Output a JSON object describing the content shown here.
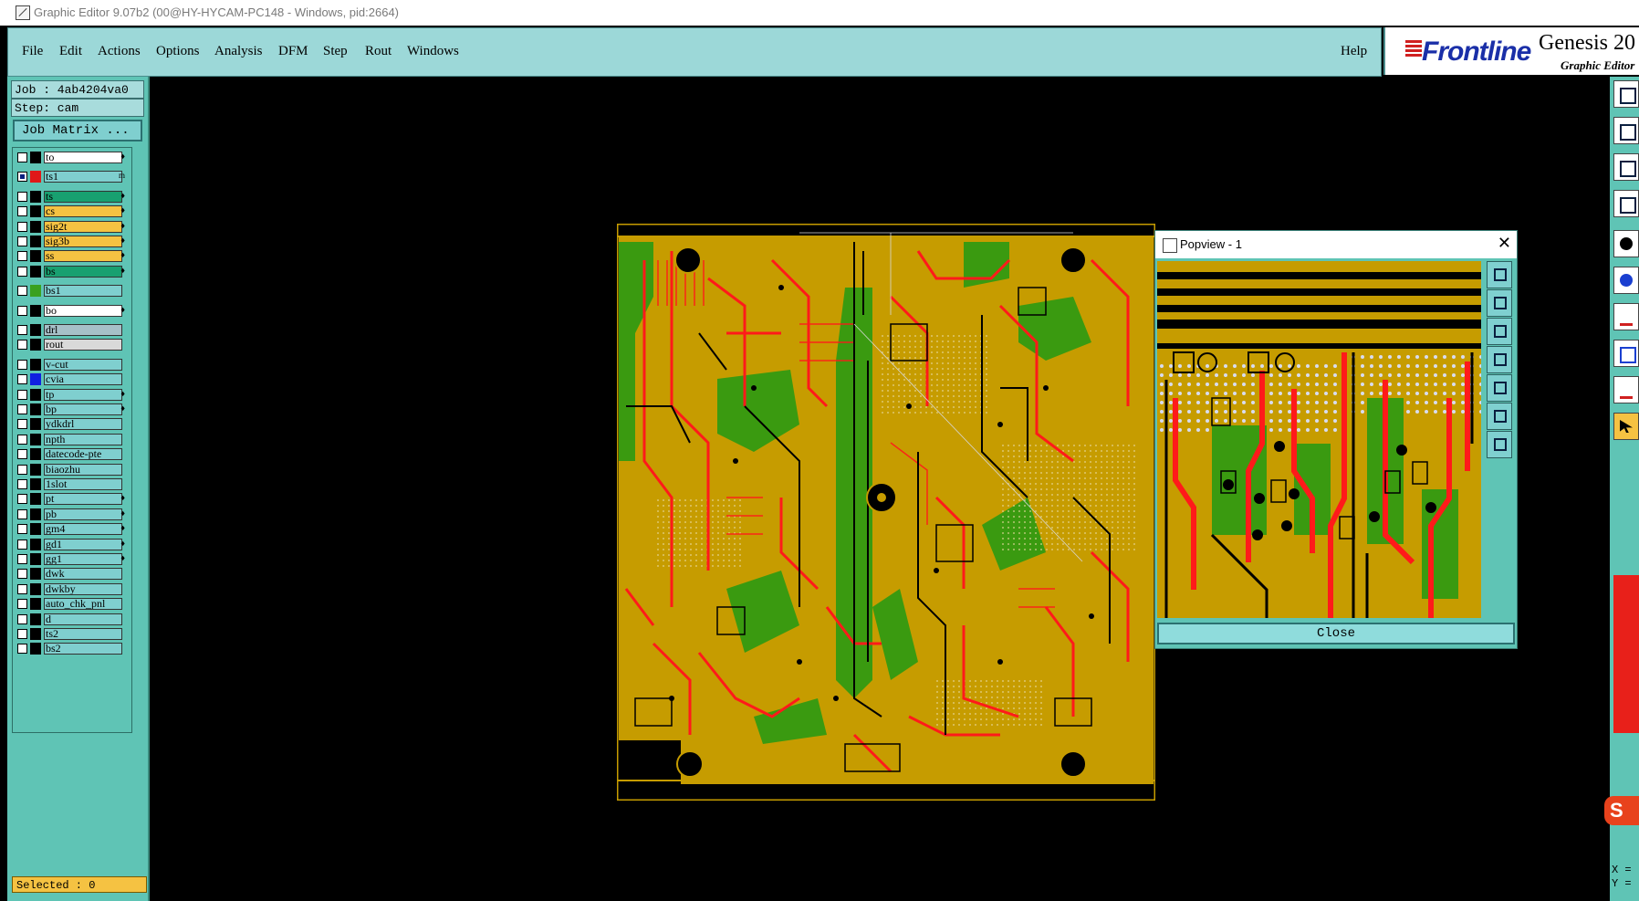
{
  "window": {
    "title": "Graphic Editor 9.07b2 (00@HY-HYCAM-PC148 - Windows, pid:2664)"
  },
  "menu": {
    "items": [
      "File",
      "Edit",
      "Actions",
      "Options",
      "Analysis",
      "DFM",
      "Step",
      "Rout",
      "Windows"
    ],
    "help": "Help"
  },
  "brand": {
    "logo": "Frontline",
    "product": "Genesis 20",
    "subtitle": "Graphic Editor"
  },
  "job": {
    "job": "Job : 4ab4204va0",
    "step": "Step: cam",
    "matrix_button": "Job Matrix ..."
  },
  "layers": [
    {
      "name": "to",
      "color": "#ffffff",
      "swatch": "#000000",
      "flag": "♦"
    },
    {
      "name": "ts1",
      "color": "#7fcfcf",
      "swatch": "#e01818",
      "flag": "m",
      "checked": true
    },
    {
      "name": "ts",
      "color": "#18a070",
      "swatch": "#000000",
      "flag": "♦"
    },
    {
      "name": "cs",
      "color": "#f5c242",
      "swatch": "#000000",
      "flag": "♦"
    },
    {
      "name": "sig2t",
      "color": "#f5c242",
      "swatch": "#000000",
      "flag": "♦"
    },
    {
      "name": "sig3b",
      "color": "#f5c242",
      "swatch": "#000000",
      "flag": "♦"
    },
    {
      "name": "ss",
      "color": "#f5c242",
      "swatch": "#000000",
      "flag": "♦"
    },
    {
      "name": "bs",
      "color": "#18a070",
      "swatch": "#000000",
      "flag": "♦"
    },
    {
      "name": "bs1",
      "color": "#7fcfcf",
      "swatch": "#3aa020",
      "flag": ""
    },
    {
      "name": "bo",
      "color": "#ffffff",
      "swatch": "#000000",
      "flag": "♦"
    },
    {
      "name": "drl",
      "color": "#a7c0c8",
      "swatch": "#000000",
      "flag": ""
    },
    {
      "name": "rout",
      "color": "#d9d9d9",
      "swatch": "#000000",
      "flag": ""
    },
    {
      "name": "v-cut",
      "color": "#7fcfcf",
      "swatch": "#000000",
      "flag": ""
    },
    {
      "name": "cvia",
      "color": "#7fcfcf",
      "swatch": "#1020e0",
      "flag": ""
    },
    {
      "name": "tp",
      "color": "#7fcfcf",
      "swatch": "#000000",
      "flag": "♦"
    },
    {
      "name": "bp",
      "color": "#7fcfcf",
      "swatch": "#000000",
      "flag": "♦"
    },
    {
      "name": "ydkdrl",
      "color": "#7fcfcf",
      "swatch": "#000000",
      "flag": ""
    },
    {
      "name": "npth",
      "color": "#7fcfcf",
      "swatch": "#000000",
      "flag": ""
    },
    {
      "name": "datecode-pte",
      "color": "#7fcfcf",
      "swatch": "#000000",
      "flag": ""
    },
    {
      "name": "biaozhu",
      "color": "#7fcfcf",
      "swatch": "#000000",
      "flag": ""
    },
    {
      "name": "1slot",
      "color": "#7fcfcf",
      "swatch": "#000000",
      "flag": ""
    },
    {
      "name": "pt",
      "color": "#7fcfcf",
      "swatch": "#000000",
      "flag": "♦"
    },
    {
      "name": "pb",
      "color": "#7fcfcf",
      "swatch": "#000000",
      "flag": "♦"
    },
    {
      "name": "gm4",
      "color": "#7fcfcf",
      "swatch": "#000000",
      "flag": "♦"
    },
    {
      "name": "gd1",
      "color": "#7fcfcf",
      "swatch": "#000000",
      "flag": "♦"
    },
    {
      "name": "gg1",
      "color": "#7fcfcf",
      "swatch": "#000000",
      "flag": "♦"
    },
    {
      "name": "dwk",
      "color": "#7fcfcf",
      "swatch": "#000000",
      "flag": ""
    },
    {
      "name": "dwkby",
      "color": "#7fcfcf",
      "swatch": "#000000",
      "flag": ""
    },
    {
      "name": "auto_chk_pnl",
      "color": "#7fcfcf",
      "swatch": "#000000",
      "flag": ""
    },
    {
      "name": "d",
      "color": "#7fcfcf",
      "swatch": "#000000",
      "flag": ""
    },
    {
      "name": "ts2",
      "color": "#7fcfcf",
      "swatch": "#000000",
      "flag": ""
    },
    {
      "name": "bs2",
      "color": "#7fcfcf",
      "swatch": "#000000",
      "flag": ""
    }
  ],
  "status": {
    "selected": "Selected : 0"
  },
  "coords": {
    "x": "X =",
    "y": "Y ="
  },
  "popview": {
    "title": "Popview - 1",
    "close": "Close",
    "close_x": "✕"
  },
  "colors": {
    "gold": "#c69c00",
    "copper_red": "#ff1a1a",
    "green": "#3a9a10",
    "panel": "#5fc4b5",
    "menu": "#9cd8d8"
  }
}
